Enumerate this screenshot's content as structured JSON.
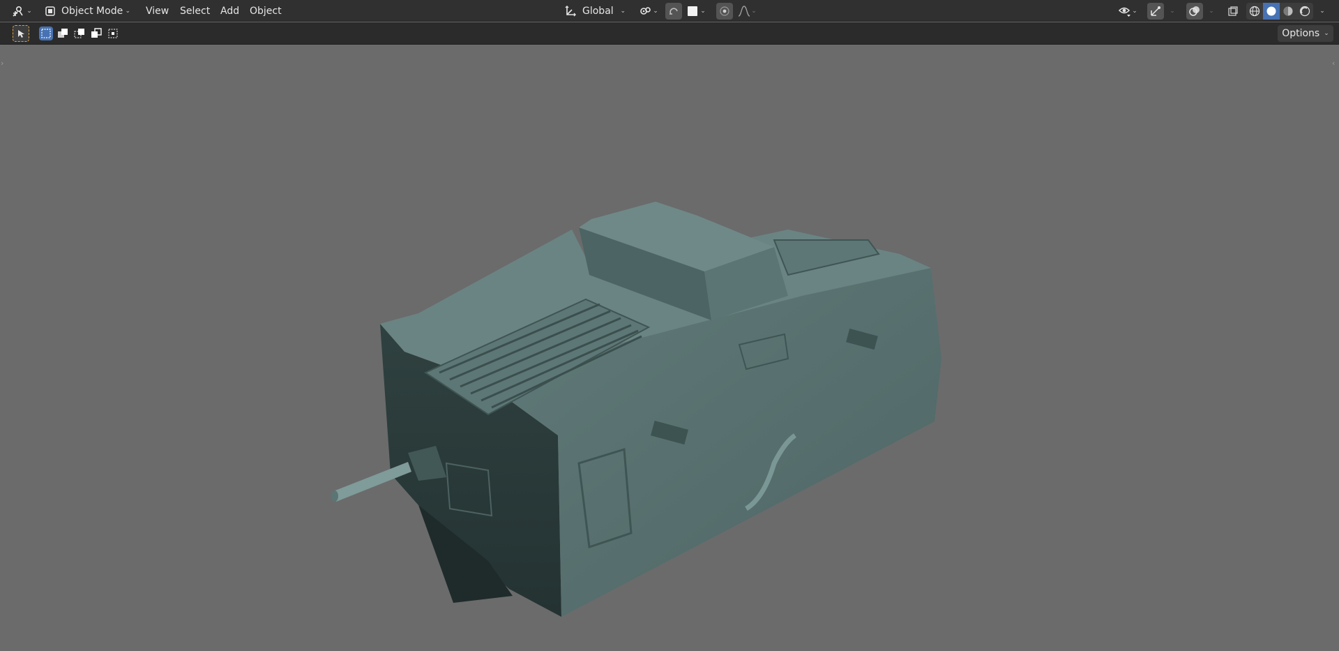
{
  "header": {
    "editor_type_icon": "3d-viewport-icon",
    "mode_label": "Object Mode",
    "menus": [
      "View",
      "Select",
      "Add",
      "Object"
    ],
    "transform_orientation": "Global"
  },
  "toolheader": {
    "options_label": "Options"
  },
  "colors": {
    "header_bg": "#303030",
    "toolheader_bg": "#2b2b2b",
    "viewport_bg": "#6b6b6b",
    "accent": "#4772b3",
    "model_color": "#5d7474"
  }
}
